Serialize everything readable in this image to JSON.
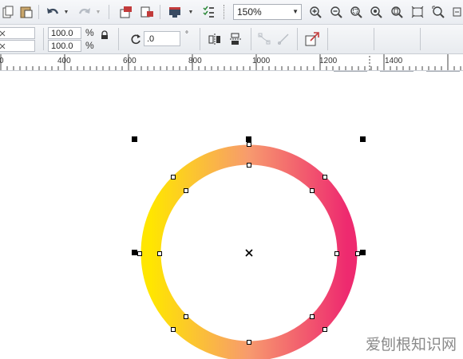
{
  "toolbar": {
    "zoom_value": "150%"
  },
  "property_bar": {
    "scale_x": "100.0",
    "scale_y": "100.0",
    "pct_symbol": "%",
    "rotation_value": ".0",
    "degree_symbol": "°"
  },
  "ruler": {
    "labels": [
      "0",
      "400",
      "600",
      "800",
      "1000",
      "1200",
      "1400"
    ]
  },
  "watermark": "爱刨根知识网",
  "colors": {
    "ring_gradient_start": "#ffe600",
    "ring_gradient_mid": "#f79a6e",
    "ring_gradient_end": "#ee2a6f"
  }
}
